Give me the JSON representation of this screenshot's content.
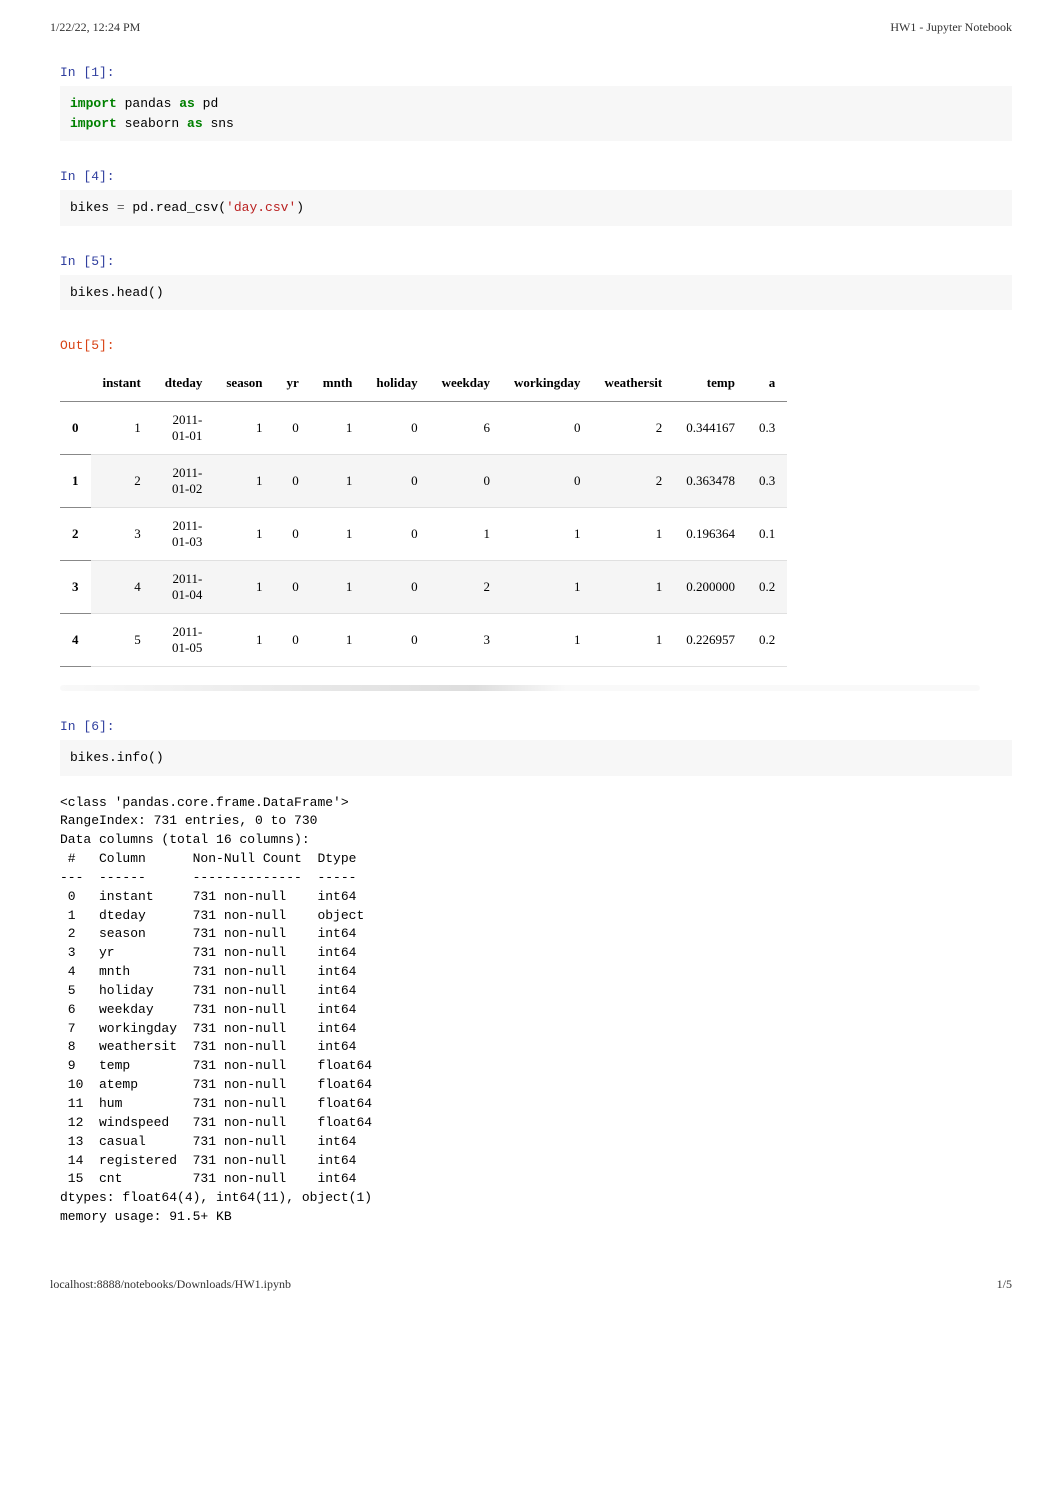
{
  "header": {
    "left": "1/22/22, 12:24 PM",
    "right": "HW1 - Jupyter Notebook"
  },
  "cells": {
    "c1": {
      "prompt": "In [1]:",
      "code": {
        "kw_import_1": "import",
        "mod_1": " pandas ",
        "kw_as_1": "as",
        "alias_1": " pd",
        "kw_import_2": "import",
        "mod_2": " seaborn ",
        "kw_as_2": "as",
        "alias_2": " sns"
      }
    },
    "c2": {
      "prompt": "In [4]:",
      "code": {
        "var": "bikes ",
        "eq": "=",
        "call": " pd.read_csv(",
        "str": "'day.csv'",
        "close": ")"
      }
    },
    "c3": {
      "prompt": "In [5]:",
      "code": "bikes.head()",
      "out_prompt": "Out[5]:",
      "table": {
        "headers": [
          "",
          "instant",
          "dteday",
          "season",
          "yr",
          "mnth",
          "holiday",
          "weekday",
          "workingday",
          "weathersit",
          "temp",
          "a"
        ],
        "rows": [
          [
            "0",
            "1",
            "2011-01-01",
            "1",
            "0",
            "1",
            "0",
            "6",
            "0",
            "2",
            "0.344167",
            "0.3"
          ],
          [
            "1",
            "2",
            "2011-01-02",
            "1",
            "0",
            "1",
            "0",
            "0",
            "0",
            "2",
            "0.363478",
            "0.3"
          ],
          [
            "2",
            "3",
            "2011-01-03",
            "1",
            "0",
            "1",
            "0",
            "1",
            "1",
            "1",
            "0.196364",
            "0.1"
          ],
          [
            "3",
            "4",
            "2011-01-04",
            "1",
            "0",
            "1",
            "0",
            "2",
            "1",
            "1",
            "0.200000",
            "0.2"
          ],
          [
            "4",
            "5",
            "2011-01-05",
            "1",
            "0",
            "1",
            "0",
            "3",
            "1",
            "1",
            "0.226957",
            "0.2"
          ]
        ]
      }
    },
    "c4": {
      "prompt": "In [6]:",
      "code": "bikes.info()",
      "stdout_lines": [
        "<class 'pandas.core.frame.DataFrame'>",
        "RangeIndex: 731 entries, 0 to 730",
        "Data columns (total 16 columns):",
        " #   Column      Non-Null Count  Dtype  ",
        "---  ------      --------------  -----  ",
        " 0   instant     731 non-null    int64  ",
        " 1   dteday      731 non-null    object ",
        " 2   season      731 non-null    int64  ",
        " 3   yr          731 non-null    int64  ",
        " 4   mnth        731 non-null    int64  ",
        " 5   holiday     731 non-null    int64  ",
        " 6   weekday     731 non-null    int64  ",
        " 7   workingday  731 non-null    int64  ",
        " 8   weathersit  731 non-null    int64  ",
        " 9   temp        731 non-null    float64",
        " 10  atemp       731 non-null    float64",
        " 11  hum         731 non-null    float64",
        " 12  windspeed   731 non-null    float64",
        " 13  casual      731 non-null    int64  ",
        " 14  registered  731 non-null    int64  ",
        " 15  cnt         731 non-null    int64  ",
        "dtypes: float64(4), int64(11), object(1)",
        "memory usage: 91.5+ KB"
      ]
    }
  },
  "footer": {
    "left": "localhost:8888/notebooks/Downloads/HW1.ipynb",
    "right": "1/5"
  }
}
